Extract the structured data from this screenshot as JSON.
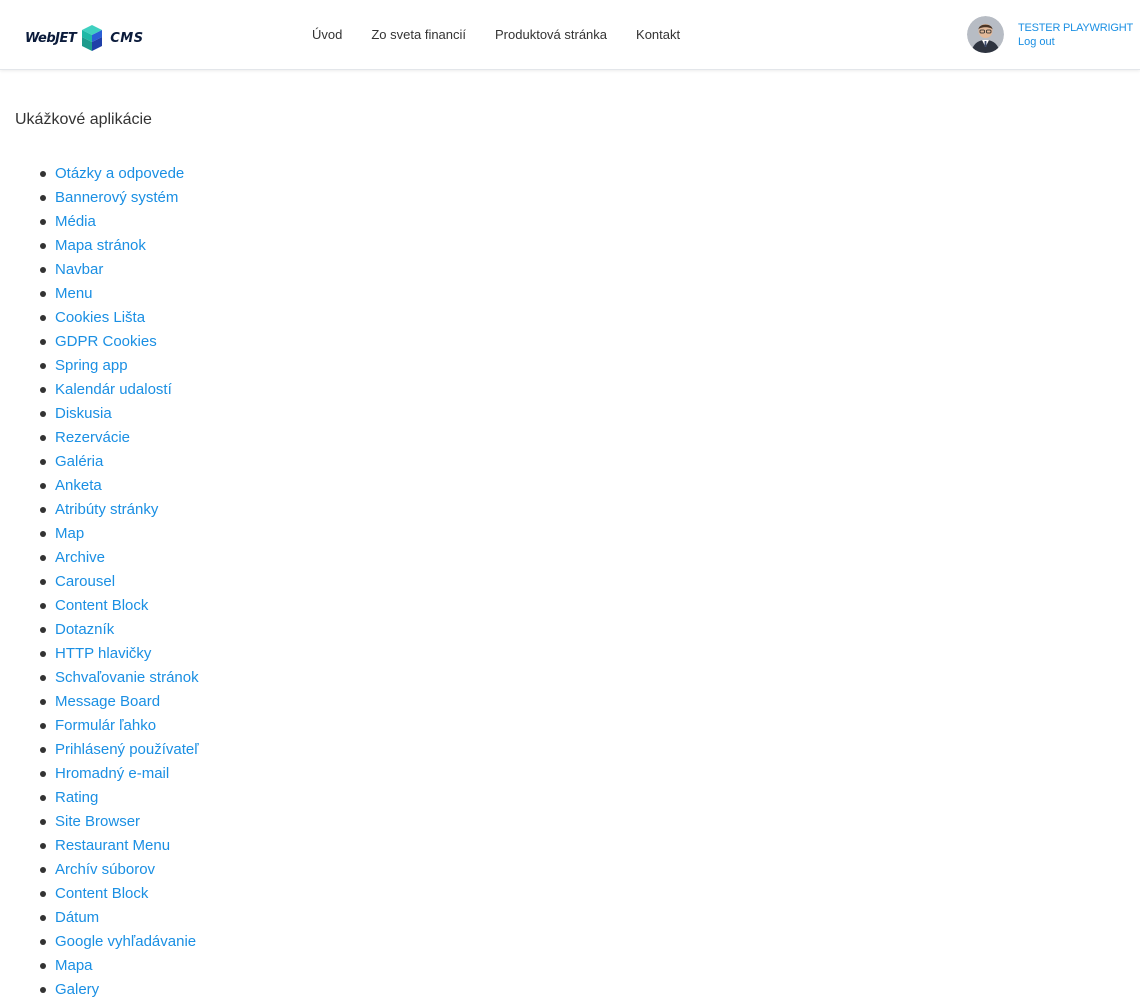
{
  "header": {
    "logo": {
      "left_text": "WebJET",
      "right_text": "CMS",
      "icon": "webjet-cube-logo"
    },
    "nav": [
      {
        "label": "Úvod"
      },
      {
        "label": "Zo sveta financií"
      },
      {
        "label": "Produktová stránka"
      },
      {
        "label": "Kontakt"
      }
    ],
    "user": {
      "name": "TESTER PLAYWRIGHT",
      "logout_label": "Log out",
      "avatar_icon": "user-avatar"
    }
  },
  "main": {
    "title": "Ukážkové aplikácie",
    "apps": [
      "Otázky a odpovede",
      "Bannerový systém",
      "Média",
      "Mapa stránok",
      "Navbar",
      "Menu",
      "Cookies Lišta",
      "GDPR Cookies",
      "Spring app",
      "Kalendár udalostí",
      "Diskusia",
      "Rezervácie",
      "Galéria",
      "Anketa",
      "Atribúty stránky",
      "Map",
      "Archive",
      "Carousel",
      "Content Block",
      "Dotazník",
      "HTTP hlavičky",
      "Schvaľovanie stránok",
      "Message Board",
      "Formulár ľahko",
      "Prihlásený používateľ",
      "Hromadný e-mail",
      "Rating",
      "Site Browser",
      "Restaurant Menu",
      "Archív súborov",
      "Content Block",
      "Dátum",
      "Google vyhľadávanie",
      "Mapa",
      "Galery"
    ]
  },
  "colors": {
    "link": "#1a8fe3",
    "text": "#333333",
    "logo_dark": "#0b1b3b",
    "cube_teal": "#1fb8a6",
    "cube_blue": "#2a5fd6"
  }
}
